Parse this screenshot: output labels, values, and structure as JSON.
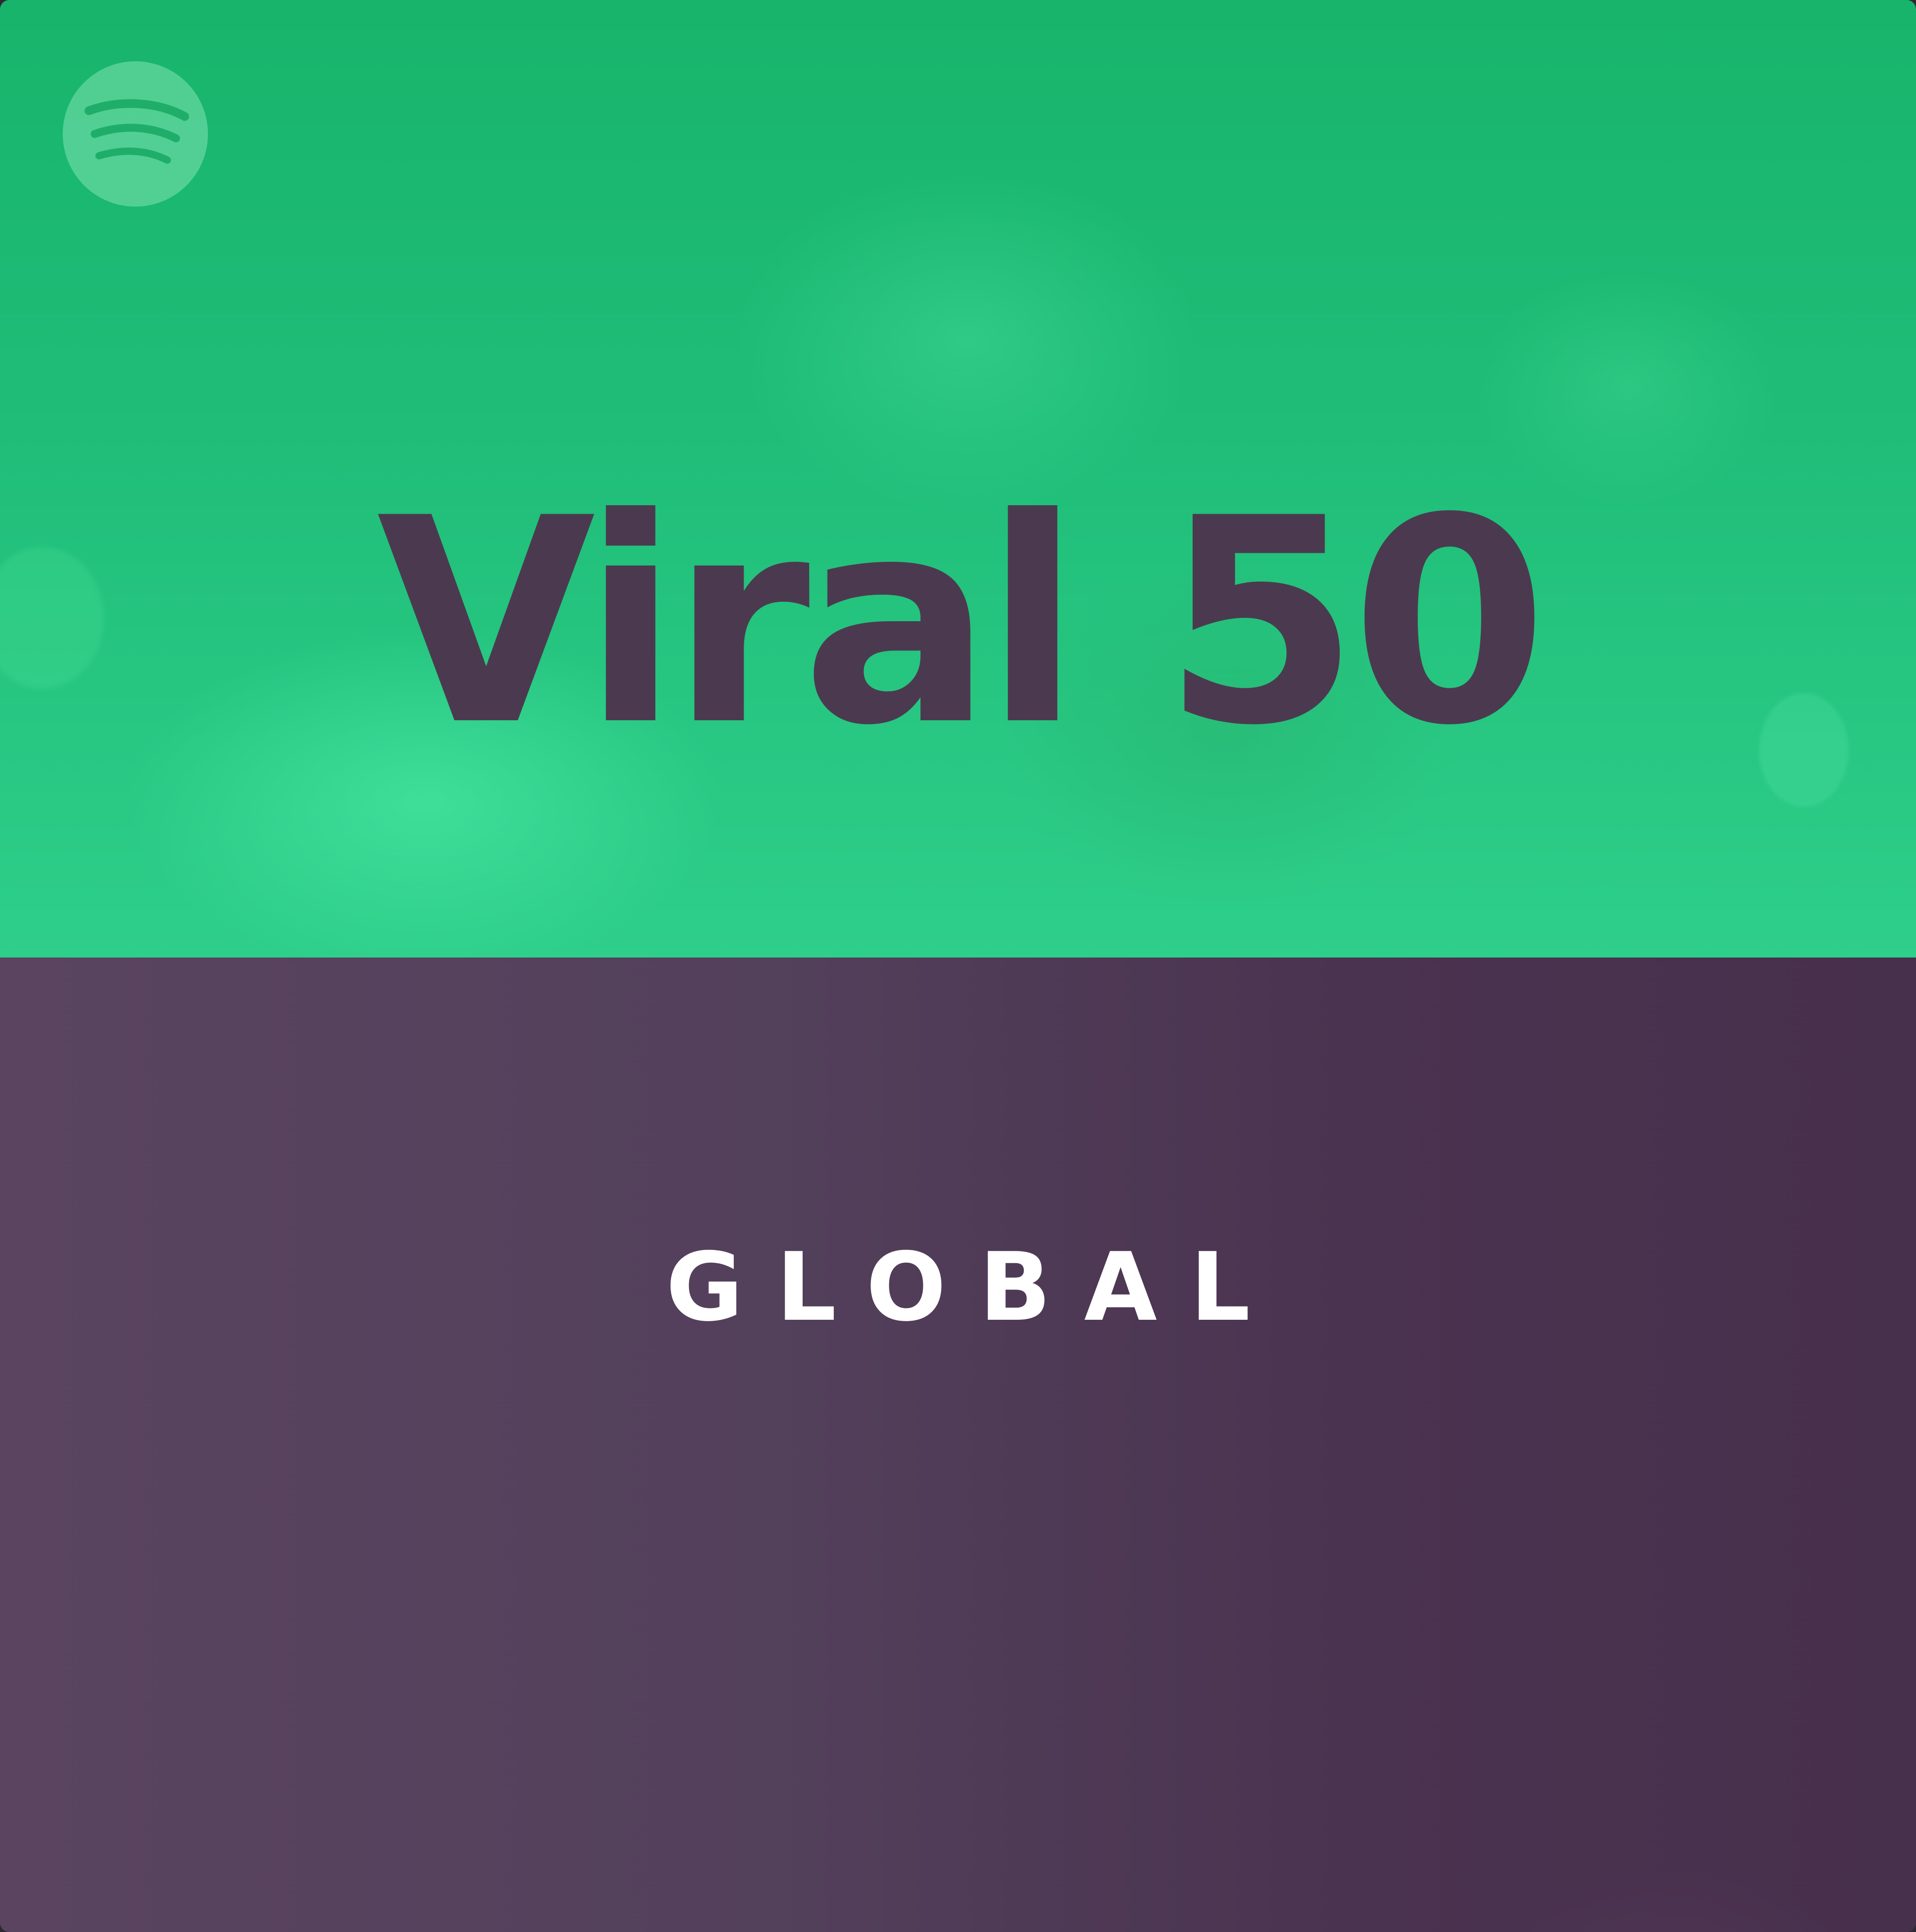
{
  "cover": {
    "title": "Viral 50",
    "subtitle": "GLOBAL",
    "logo_icon": "spotify-logo-icon",
    "colors": {
      "top_band": "#1fbd78",
      "bottom_band": "#4d3850",
      "title_text": "#4b3a4f",
      "subtitle_text": "#ffffff",
      "logo_circle": "#5cd39a",
      "logo_waves": "#1fae69"
    }
  }
}
